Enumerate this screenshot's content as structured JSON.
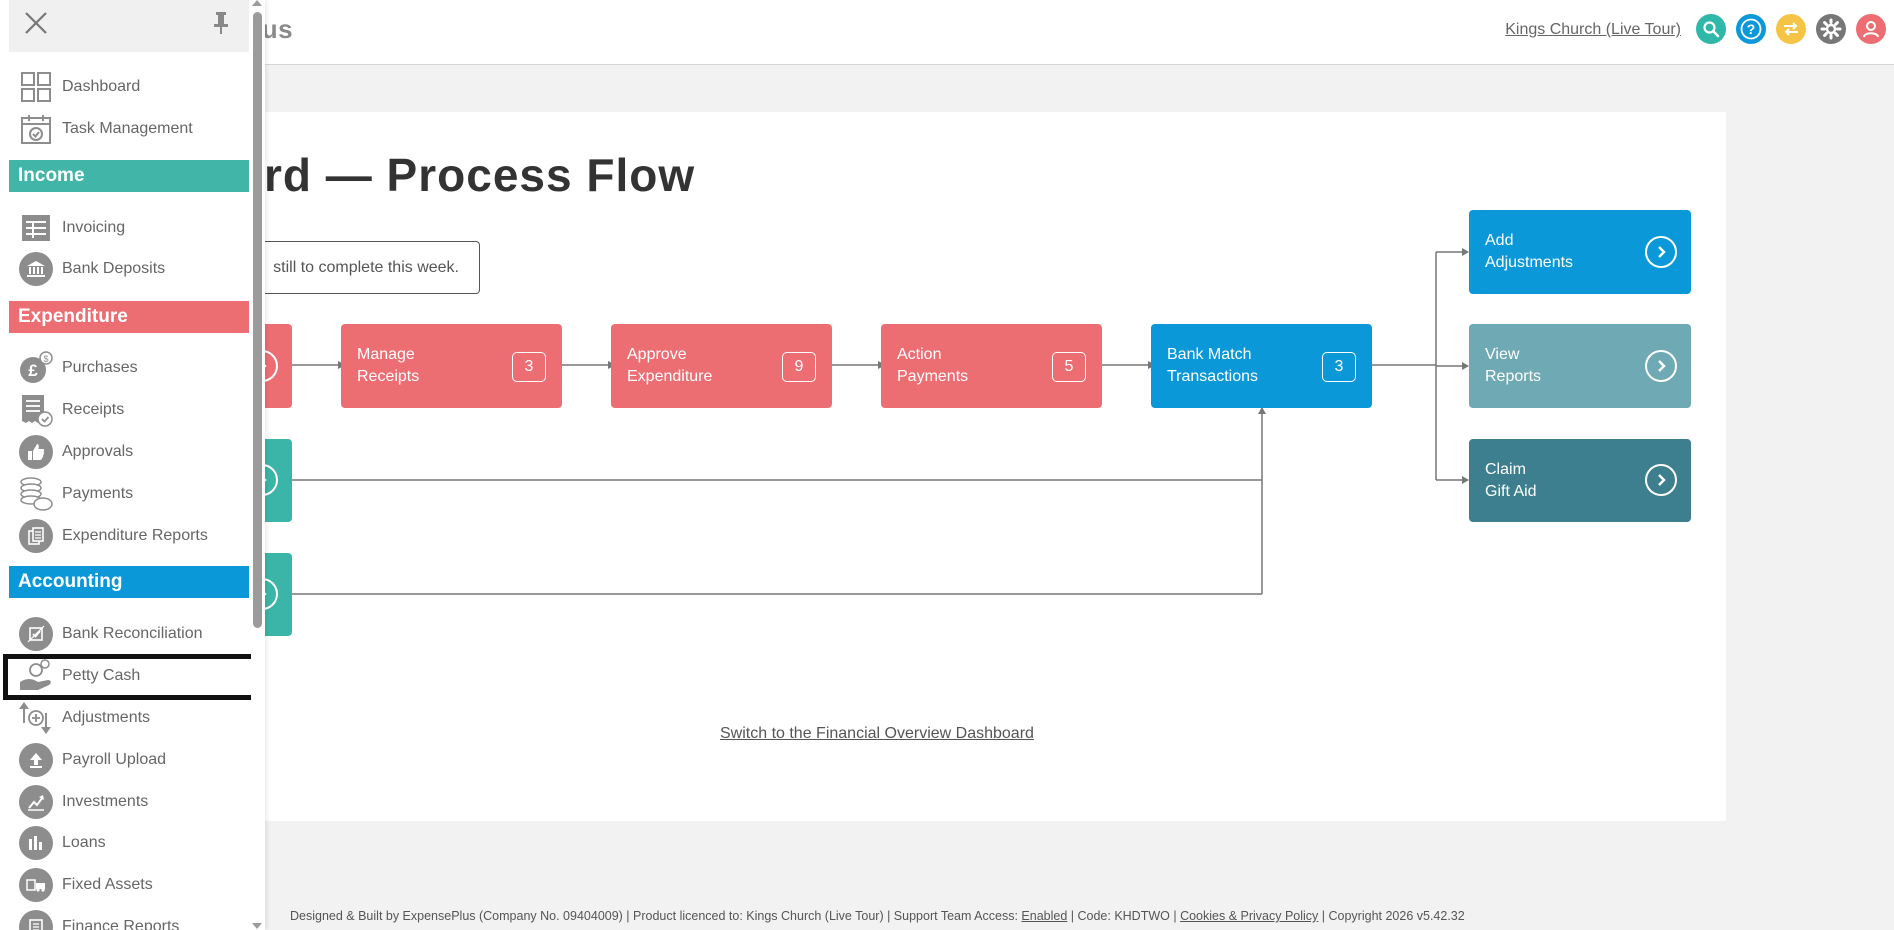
{
  "header": {
    "logo_text": "lus",
    "org_link": "Kings Church (Live Tour)",
    "icons": [
      "search-icon",
      "help-icon",
      "switch-icon",
      "settings-icon",
      "user-icon"
    ],
    "icon_colors": [
      "#2fb7a9",
      "#0a98d8",
      "#f6c445",
      "#777777",
      "#ec6e72"
    ]
  },
  "main": {
    "title": "rd — Process Flow",
    "notice": "still to complete this week.",
    "switch_link": "Switch to the Financial Overview Dashboard",
    "flow": {
      "manage_receipts": {
        "label": "Manage Receipts",
        "line1": "Manage",
        "line2": "Receipts",
        "count": "3"
      },
      "approve_expenditure": {
        "label": "Approve Expenditure",
        "line1": "Approve",
        "line2": "Expenditure",
        "count": "9"
      },
      "action_payments": {
        "label": "Action Payments",
        "line1": "Action",
        "line2": "Payments",
        "count": "5"
      },
      "bank_match": {
        "label": "Bank Match Transactions",
        "line1": "Bank Match",
        "line2": "Transactions",
        "count": "3"
      },
      "add_adjustments": {
        "line1": "Add",
        "line2": "Adjustments"
      },
      "view_reports": {
        "line1": "View",
        "line2": "Reports"
      },
      "claim_gift_aid": {
        "line1": "Claim",
        "line2": "Gift Aid"
      }
    }
  },
  "footer": {
    "text1": "Designed & Built by ExpensePlus (Company No. 09404009) | Product licenced to: Kings Church (Live Tour) | Support Team Access: ",
    "enabled": "Enabled",
    "text2": " | Code: KHDTWO | ",
    "cookies": "Cookies & Privacy Policy",
    "text3": " | Copyright 2026 v5.42.32"
  },
  "sidebar": {
    "top_items": [
      {
        "label": "Dashboard",
        "icon": "dashboard-icon"
      },
      {
        "label": "Task Management",
        "icon": "calendar-icon"
      }
    ],
    "sections": {
      "income": "Income",
      "expenditure": "Expenditure",
      "accounting": "Accounting"
    },
    "income_items": [
      {
        "label": "Invoicing",
        "icon": "invoice-icon"
      },
      {
        "label": "Bank Deposits",
        "icon": "bank-icon"
      }
    ],
    "expenditure_items": [
      {
        "label": "Purchases",
        "icon": "purchases-icon"
      },
      {
        "label": "Receipts",
        "icon": "receipt-icon"
      },
      {
        "label": "Approvals",
        "icon": "thumbs-up-icon"
      },
      {
        "label": "Payments",
        "icon": "coins-icon"
      },
      {
        "label": "Expenditure Reports",
        "icon": "reports-icon"
      }
    ],
    "accounting_items": [
      {
        "label": "Bank Reconciliation",
        "icon": "reconcile-icon"
      },
      {
        "label": "Petty Cash",
        "icon": "petty-cash-icon"
      },
      {
        "label": "Adjustments",
        "icon": "adjustments-icon"
      },
      {
        "label": "Payroll Upload",
        "icon": "upload-icon"
      },
      {
        "label": "Investments",
        "icon": "chart-icon"
      },
      {
        "label": "Loans",
        "icon": "loans-icon"
      },
      {
        "label": "Fixed Assets",
        "icon": "fixed-assets-icon"
      },
      {
        "label": "Finance Reports",
        "icon": "finance-reports-icon"
      }
    ]
  }
}
